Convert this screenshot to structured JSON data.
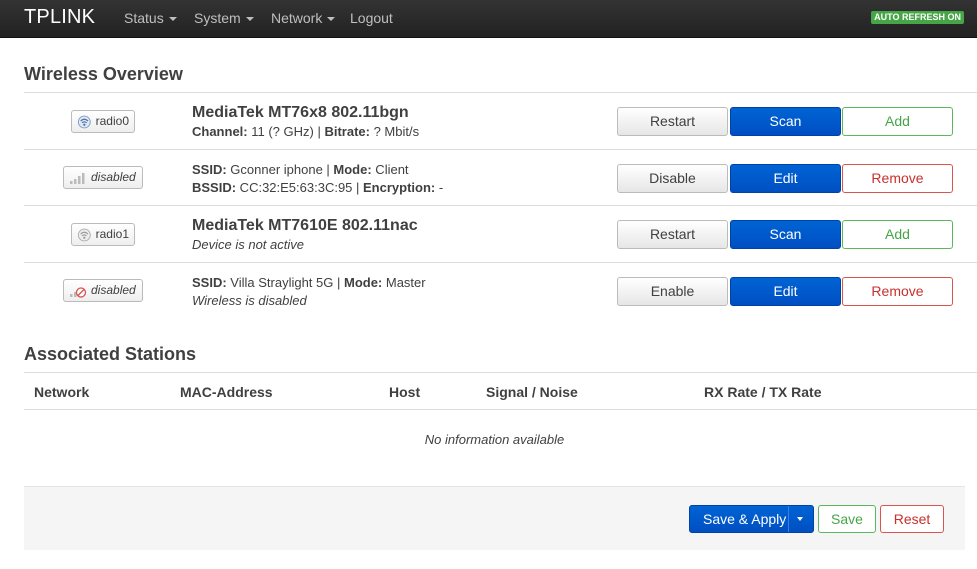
{
  "navbar": {
    "brand": "TPLINK",
    "menu": [
      {
        "label": "Status"
      },
      {
        "label": "System"
      },
      {
        "label": "Network"
      },
      {
        "label": "Logout"
      }
    ],
    "auto_refresh": "AUTO REFRESH ON"
  },
  "wireless": {
    "title": "Wireless Overview",
    "radio0": {
      "badge": "radio0",
      "name": "MediaTek MT76x8 802.11bgn",
      "channel_label": "Channel:",
      "channel_value": " 11 (? GHz) | ",
      "bitrate_label": "Bitrate:",
      "bitrate_value": " ? Mbit/s",
      "buttons": {
        "restart": "Restart",
        "scan": "Scan",
        "add": "Add"
      }
    },
    "net0": {
      "badge": "disabled",
      "ssid_label": "SSID:",
      "ssid_value": " Gconner iphone | ",
      "mode_label": "Mode:",
      "mode_value": " Client",
      "bssid_label": "BSSID:",
      "bssid_value": " CC:32:E5:63:3C:95 | ",
      "enc_label": "Encryption:",
      "enc_value": " -",
      "buttons": {
        "toggle": "Disable",
        "edit": "Edit",
        "remove": "Remove"
      }
    },
    "radio1": {
      "badge": "radio1",
      "name": "MediaTek MT7610E 802.11nac",
      "status": "Device is not active",
      "buttons": {
        "restart": "Restart",
        "scan": "Scan",
        "add": "Add"
      }
    },
    "net1": {
      "badge": "disabled",
      "ssid_label": "SSID:",
      "ssid_value": " Villa Straylight 5G | ",
      "mode_label": "Mode:",
      "mode_value": " Master",
      "status": "Wireless is disabled",
      "buttons": {
        "toggle": "Enable",
        "edit": "Edit",
        "remove": "Remove"
      }
    }
  },
  "stations": {
    "title": "Associated Stations",
    "columns": [
      "Network",
      "MAC-Address",
      "Host",
      "Signal / Noise",
      "RX Rate / TX Rate"
    ],
    "empty": "No information available"
  },
  "actions": {
    "save_apply": "Save & Apply",
    "save": "Save",
    "reset": "Reset"
  }
}
